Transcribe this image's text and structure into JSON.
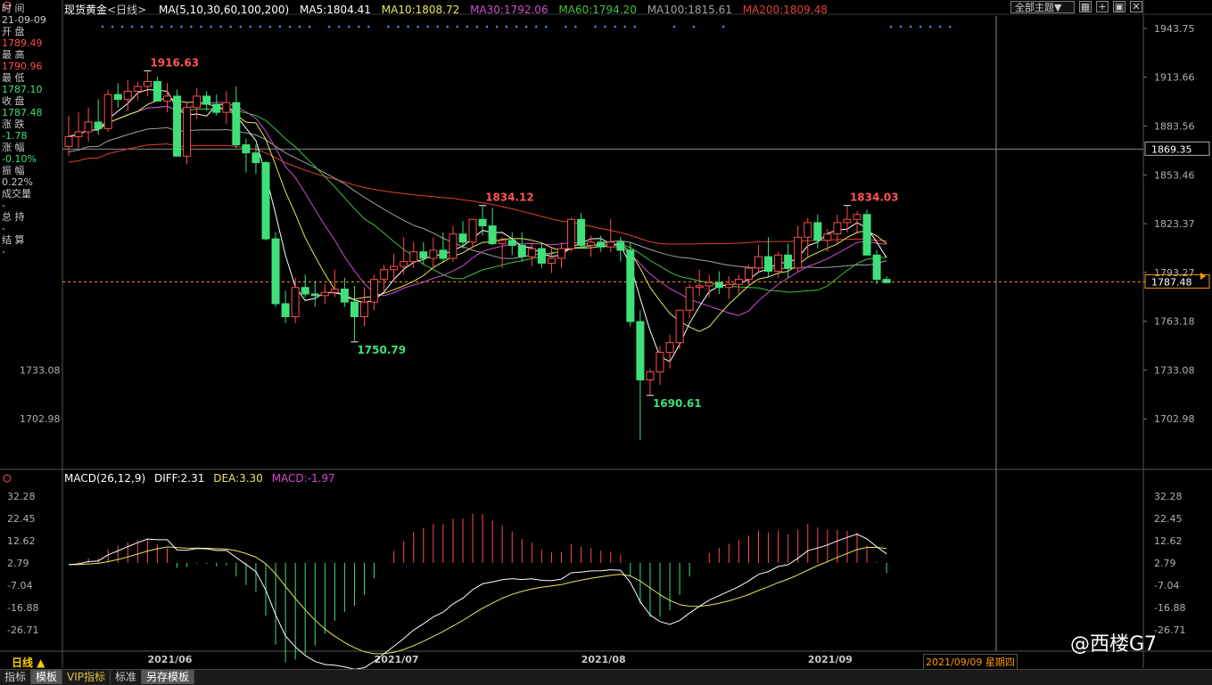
{
  "header": {
    "title": "现货黄金",
    "period_tag": "<日线>",
    "ma_label": "MA(5,10,30,60,100,200)",
    "ma5": "MA5:1804.41",
    "ma10": "MA10:1808.72",
    "ma30": "MA30:1792.06",
    "ma60": "MA60:1794.20",
    "ma100": "MA100:1815.61",
    "ma200": "MA200:1809.48",
    "theme_button": "全部主题▼"
  },
  "info_panel": {
    "time_label": "时 间",
    "time_value": "21-09-09",
    "open_label": "开 盘",
    "open_value": "1789.49",
    "high_label": "最 高",
    "high_value": "1790.96",
    "low_label": "最 低",
    "low_value": "1787.10",
    "close_label": "收 盘",
    "close_value": "1787.48",
    "change_label": "涨 跌",
    "change_value": "-1.78",
    "pct_label": "涨 幅",
    "pct_value": "-0.10%",
    "amp_label": "振 幅",
    "amp_value": "0.22%",
    "vol_label": "成交量",
    "vol_value": "-",
    "hold_label": "总 持",
    "hold_value": "-",
    "settle_label": "结 算",
    "settle_value": "-"
  },
  "macd_header": {
    "label": "MACD(26,12,9)",
    "diff": "DIFF:2.31",
    "dea": "DEA:3.30",
    "macd": "MACD:-1.97"
  },
  "bottom": {
    "period_button": "日线 ▲",
    "tabs": [
      "指标",
      "模板",
      "VIP指标",
      "标准",
      "另存模板"
    ],
    "date_display": "2021/09/09 星期四",
    "watermark": "@西楼G7"
  },
  "colors": {
    "up": "#ff4d4d",
    "down": "#3fe07a",
    "ma5": "#ffffff",
    "ma10": "#e6e65c",
    "ma30": "#d04dd0",
    "ma60": "#40c040",
    "ma100": "#a0a0a0",
    "ma200": "#e04030"
  },
  "chart_data": {
    "type": "candlestick",
    "price_ylim": [
      1672.9,
      1951.4
    ],
    "price_ticks": [
      "1943.75",
      "1913.66",
      "1883.56",
      "1853.46",
      "1823.37",
      "1793.27",
      "1763.18",
      "1733.08",
      "1702.98"
    ],
    "price_tick_values": [
      1943.75,
      1913.66,
      1883.56,
      1853.46,
      1823.37,
      1793.27,
      1763.18,
      1733.08,
      1702.98
    ],
    "left_axis_label": "1733.08",
    "left_axis_label2": "1702.98",
    "crosshair_price": "1869.35",
    "current_price": "1787.48",
    "annotations": [
      {
        "text": "1916.63",
        "kind": "high",
        "index": 8
      },
      {
        "text": "1750.79",
        "kind": "low",
        "index": 29
      },
      {
        "text": "1834.12",
        "kind": "high",
        "index": 42
      },
      {
        "text": "1690.61",
        "kind": "low",
        "index": 59
      },
      {
        "text": "1834.03",
        "kind": "high",
        "index": 79
      }
    ],
    "month_labels": [
      {
        "text": "2021/06",
        "index": 10
      },
      {
        "text": "2021/07",
        "index": 33
      },
      {
        "text": "2021/08",
        "index": 54
      },
      {
        "text": "2021/09",
        "index": 77
      }
    ],
    "candles": [
      [
        1871,
        1890,
        1865,
        1877
      ],
      [
        1877,
        1892,
        1870,
        1880
      ],
      [
        1880,
        1895,
        1874,
        1886
      ],
      [
        1886,
        1900,
        1878,
        1882
      ],
      [
        1882,
        1906,
        1880,
        1903
      ],
      [
        1903,
        1910,
        1895,
        1900
      ],
      [
        1900,
        1912,
        1893,
        1905
      ],
      [
        1905,
        1911,
        1899,
        1908
      ],
      [
        1908,
        1917,
        1902,
        1911
      ],
      [
        1911,
        1914,
        1899,
        1899
      ],
      [
        1899,
        1910,
        1892,
        1902
      ],
      [
        1902,
        1906,
        1868,
        1865
      ],
      [
        1865,
        1898,
        1860,
        1895
      ],
      [
        1895,
        1907,
        1888,
        1902
      ],
      [
        1902,
        1905,
        1893,
        1897
      ],
      [
        1897,
        1903,
        1890,
        1892
      ],
      [
        1892,
        1905,
        1885,
        1898
      ],
      [
        1898,
        1908,
        1870,
        1872
      ],
      [
        1872,
        1876,
        1855,
        1867
      ],
      [
        1867,
        1872,
        1854,
        1861
      ],
      [
        1861,
        1862,
        1813,
        1814
      ],
      [
        1814,
        1818,
        1772,
        1774
      ],
      [
        1774,
        1782,
        1762,
        1766
      ],
      [
        1766,
        1790,
        1762,
        1784
      ],
      [
        1784,
        1792,
        1778,
        1780
      ],
      [
        1780,
        1788,
        1772,
        1779
      ],
      [
        1779,
        1786,
        1774,
        1781
      ],
      [
        1781,
        1795,
        1778,
        1783
      ],
      [
        1783,
        1790,
        1772,
        1775
      ],
      [
        1775,
        1785,
        1751,
        1766
      ],
      [
        1766,
        1784,
        1760,
        1775
      ],
      [
        1775,
        1792,
        1770,
        1789
      ],
      [
        1789,
        1798,
        1782,
        1795
      ],
      [
        1795,
        1805,
        1788,
        1797
      ],
      [
        1797,
        1815,
        1792,
        1800
      ],
      [
        1800,
        1812,
        1796,
        1806
      ],
      [
        1806,
        1812,
        1798,
        1802
      ],
      [
        1802,
        1815,
        1796,
        1807
      ],
      [
        1807,
        1818,
        1800,
        1802
      ],
      [
        1802,
        1822,
        1800,
        1817
      ],
      [
        1817,
        1825,
        1808,
        1812
      ],
      [
        1812,
        1826,
        1808,
        1826
      ],
      [
        1826,
        1834,
        1816,
        1822
      ],
      [
        1822,
        1833,
        1810,
        1811
      ],
      [
        1811,
        1815,
        1796,
        1813
      ],
      [
        1813,
        1818,
        1804,
        1810
      ],
      [
        1810,
        1818,
        1800,
        1803
      ],
      [
        1803,
        1811,
        1797,
        1808
      ],
      [
        1808,
        1812,
        1796,
        1799
      ],
      [
        1799,
        1808,
        1793,
        1802
      ],
      [
        1802,
        1812,
        1796,
        1808
      ],
      [
        1808,
        1827,
        1806,
        1826
      ],
      [
        1826,
        1830,
        1808,
        1810
      ],
      [
        1810,
        1816,
        1803,
        1812
      ],
      [
        1812,
        1816,
        1806,
        1809
      ],
      [
        1809,
        1826,
        1806,
        1812
      ],
      [
        1812,
        1815,
        1800,
        1807
      ],
      [
        1807,
        1812,
        1760,
        1763
      ],
      [
        1763,
        1770,
        1690,
        1727
      ],
      [
        1727,
        1734,
        1718,
        1732
      ],
      [
        1732,
        1748,
        1724,
        1744
      ],
      [
        1744,
        1755,
        1734,
        1750
      ],
      [
        1750,
        1770,
        1746,
        1770
      ],
      [
        1770,
        1786,
        1765,
        1784
      ],
      [
        1784,
        1795,
        1779,
        1785
      ],
      [
        1785,
        1792,
        1778,
        1787
      ],
      [
        1787,
        1794,
        1780,
        1784
      ],
      [
        1784,
        1791,
        1777,
        1786
      ],
      [
        1786,
        1792,
        1780,
        1789
      ],
      [
        1789,
        1798,
        1785,
        1796
      ],
      [
        1796,
        1810,
        1793,
        1803
      ],
      [
        1803,
        1815,
        1790,
        1794
      ],
      [
        1794,
        1806,
        1790,
        1804
      ],
      [
        1804,
        1811,
        1790,
        1796
      ],
      [
        1796,
        1822,
        1794,
        1815
      ],
      [
        1815,
        1827,
        1802,
        1824
      ],
      [
        1824,
        1829,
        1808,
        1813
      ],
      [
        1813,
        1820,
        1806,
        1817
      ],
      [
        1817,
        1829,
        1810,
        1824
      ],
      [
        1824,
        1834,
        1818,
        1826
      ],
      [
        1826,
        1831,
        1817,
        1829
      ],
      [
        1829,
        1832,
        1806,
        1804
      ],
      [
        1804,
        1807,
        1786,
        1789
      ],
      [
        1789,
        1791,
        1787,
        1787
      ]
    ],
    "macd_ylim": [
      -36.5,
      36.5
    ],
    "macd_ticks": [
      "32.28",
      "22.45",
      "12.62",
      "2.79",
      "-7.04",
      "-16.88",
      "-26.71"
    ],
    "macd_tick_values": [
      32.28,
      22.45,
      12.62,
      2.79,
      -7.04,
      -16.88,
      -26.71
    ]
  }
}
